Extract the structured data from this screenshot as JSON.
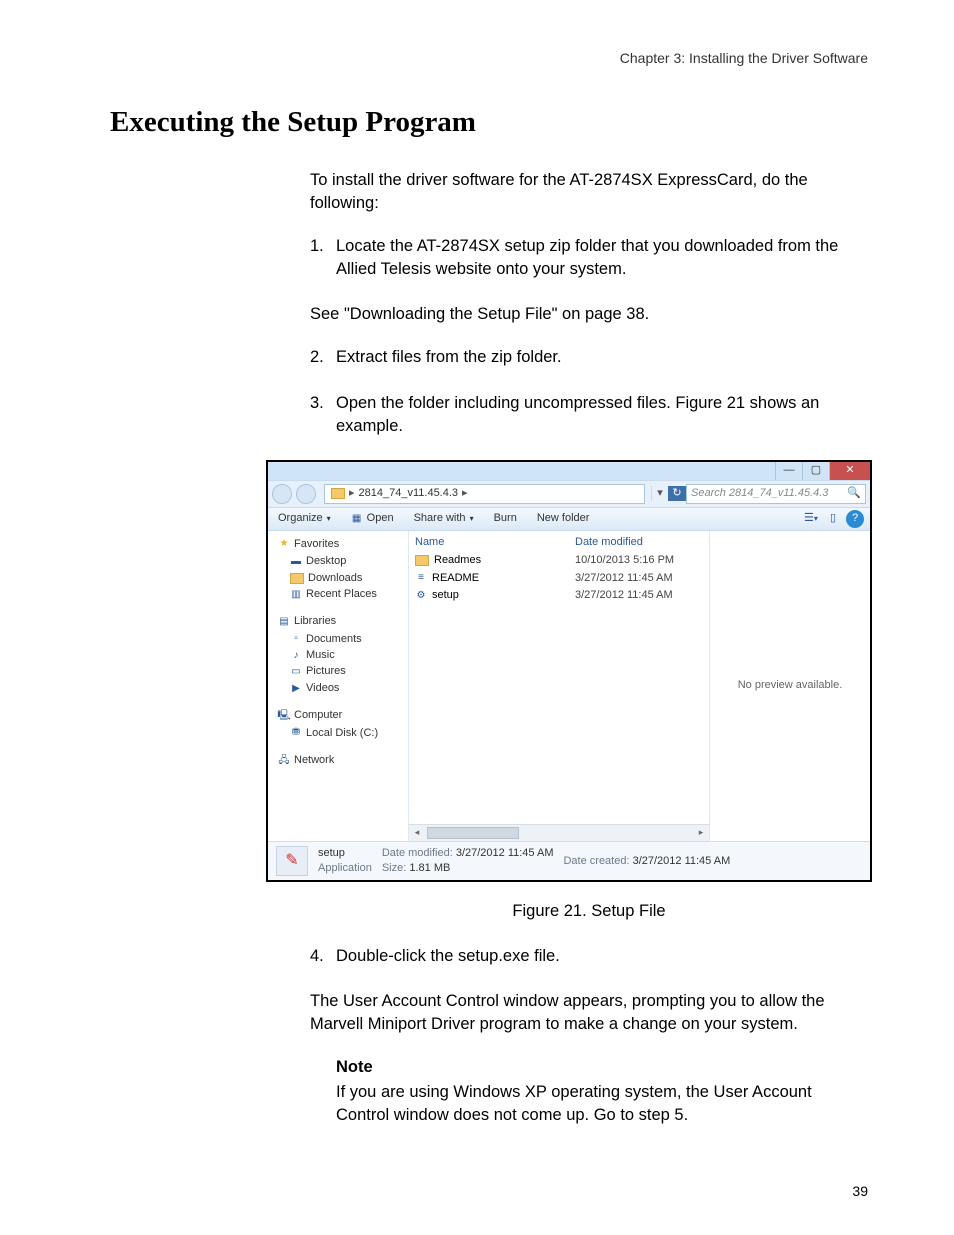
{
  "page": {
    "header": "Chapter 3: Installing the Driver Software",
    "title": "Executing the Setup Program",
    "intro": "To install the driver software for the AT-2874SX ExpressCard, do the following:",
    "step1": "Locate the AT-2874SX setup zip folder that you downloaded from the Allied Telesis website onto your system.",
    "see": "See \"Downloading the Setup File\" on page 38.",
    "step2": "Extract files from the zip folder.",
    "step3": "Open the folder including uncompressed files. Figure 21 shows an example.",
    "caption": "Figure 21. Setup File",
    "step4": "Double-click the setup.exe file.",
    "step4b": "The User Account Control window appears, prompting you to allow the Marvell Miniport Driver program to make a change on your system.",
    "note_title": "Note",
    "note_body": "If you are using Windows XP operating system, the User Account Control window does not come up. Go to step 5.",
    "number": "39"
  },
  "win": {
    "path": "2814_74_v11.45.4.3",
    "search_placeholder": "Search 2814_74_v11.45.4.3",
    "cmd": {
      "organize": "Organize",
      "open": "Open",
      "share": "Share with",
      "burn": "Burn",
      "newfolder": "New folder"
    },
    "nav": {
      "favorites": "Favorites",
      "desktop": "Desktop",
      "downloads": "Downloads",
      "recent": "Recent Places",
      "libraries": "Libraries",
      "documents": "Documents",
      "music": "Music",
      "pictures": "Pictures",
      "videos": "Videos",
      "computer": "Computer",
      "localdisk": "Local Disk (C:)",
      "network": "Network"
    },
    "cols": {
      "name": "Name",
      "date": "Date modified"
    },
    "rows": [
      {
        "name": "Readmes",
        "date": "10/10/2013 5:16 PM",
        "icon": "fld"
      },
      {
        "name": "README",
        "date": "3/27/2012 11:45 AM",
        "icon": "doc"
      },
      {
        "name": "setup",
        "date": "3/27/2012 11:45 AM",
        "icon": "exe"
      }
    ],
    "preview": "No preview available.",
    "details": {
      "name": "setup",
      "type": "Application",
      "mod_l": "Date modified:",
      "mod_v": "3/27/2012 11:45 AM",
      "size_l": "Size:",
      "size_v": "1.81 MB",
      "cre_l": "Date created:",
      "cre_v": "3/27/2012 11:45 AM"
    }
  }
}
